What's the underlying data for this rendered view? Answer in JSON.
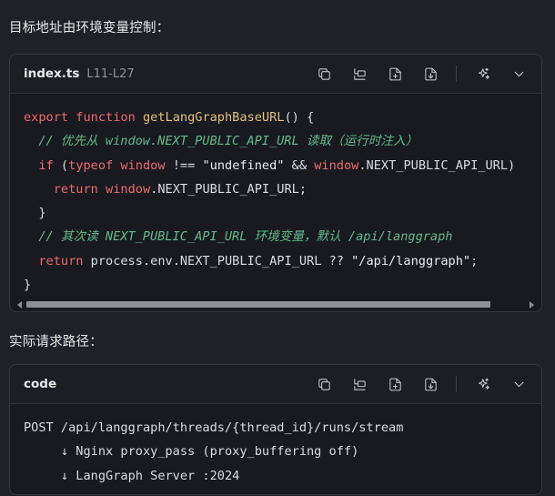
{
  "heading1": "目标地址由环境变量控制：",
  "heading2": "实际请求路径：",
  "block1": {
    "filename": "index.ts",
    "range": "L11-L27",
    "tools": [
      "copy-icon",
      "insert-icon",
      "new-file-icon",
      "save-file-icon",
      "ai-sparkle-icon",
      "chevron-down-icon"
    ],
    "lines": [
      [
        {
          "t": "kw",
          "v": "export "
        },
        {
          "t": "kw",
          "v": "function "
        },
        {
          "t": "fn",
          "v": "getLangGraphBaseURL"
        },
        {
          "t": "pl",
          "v": "() {"
        }
      ],
      [
        {
          "t": "cm",
          "v": "  // 优先从 window.NEXT_PUBLIC_API_URL 读取（运行时注入）"
        }
      ],
      [
        {
          "t": "pl",
          "v": "  "
        },
        {
          "t": "kw",
          "v": "if"
        },
        {
          "t": "pl",
          "v": " ("
        },
        {
          "t": "kw",
          "v": "typeof"
        },
        {
          "t": "pl",
          "v": " "
        },
        {
          "t": "kw",
          "v": "window"
        },
        {
          "t": "pl",
          "v": " !== "
        },
        {
          "t": "st",
          "v": "\"undefined\""
        },
        {
          "t": "pl",
          "v": " && "
        },
        {
          "t": "kw",
          "v": "window"
        },
        {
          "t": "pl",
          "v": ".NEXT_PUBLIC_API_URL)"
        }
      ],
      [
        {
          "t": "pl",
          "v": "    "
        },
        {
          "t": "kw",
          "v": "return"
        },
        {
          "t": "pl",
          "v": " "
        },
        {
          "t": "kw",
          "v": "window"
        },
        {
          "t": "pl",
          "v": ".NEXT_PUBLIC_API_URL;"
        }
      ],
      [
        {
          "t": "pl",
          "v": "  }"
        }
      ],
      [
        {
          "t": "cm",
          "v": "  // 其次读 NEXT_PUBLIC_API_URL 环境变量，默认 /api/langgraph"
        }
      ],
      [
        {
          "t": "pl",
          "v": "  "
        },
        {
          "t": "kw",
          "v": "return"
        },
        {
          "t": "pl",
          "v": " process.env.NEXT_PUBLIC_API_URL ?? "
        },
        {
          "t": "st",
          "v": "\"/api/langgraph\""
        },
        {
          "t": "pl",
          "v": ";"
        }
      ],
      [
        {
          "t": "pl",
          "v": "}"
        }
      ]
    ]
  },
  "block2": {
    "filename": "code",
    "tools": [
      "copy-icon",
      "insert-icon",
      "new-file-icon",
      "save-file-icon",
      "ai-sparkle-icon",
      "chevron-down-icon"
    ],
    "lines": [
      "POST /api/langgraph/threads/{thread_id}/runs/stream",
      "     ↓ Nginx proxy_pass (proxy_buffering off)",
      "     ↓ LangGraph Server :2024"
    ]
  }
}
